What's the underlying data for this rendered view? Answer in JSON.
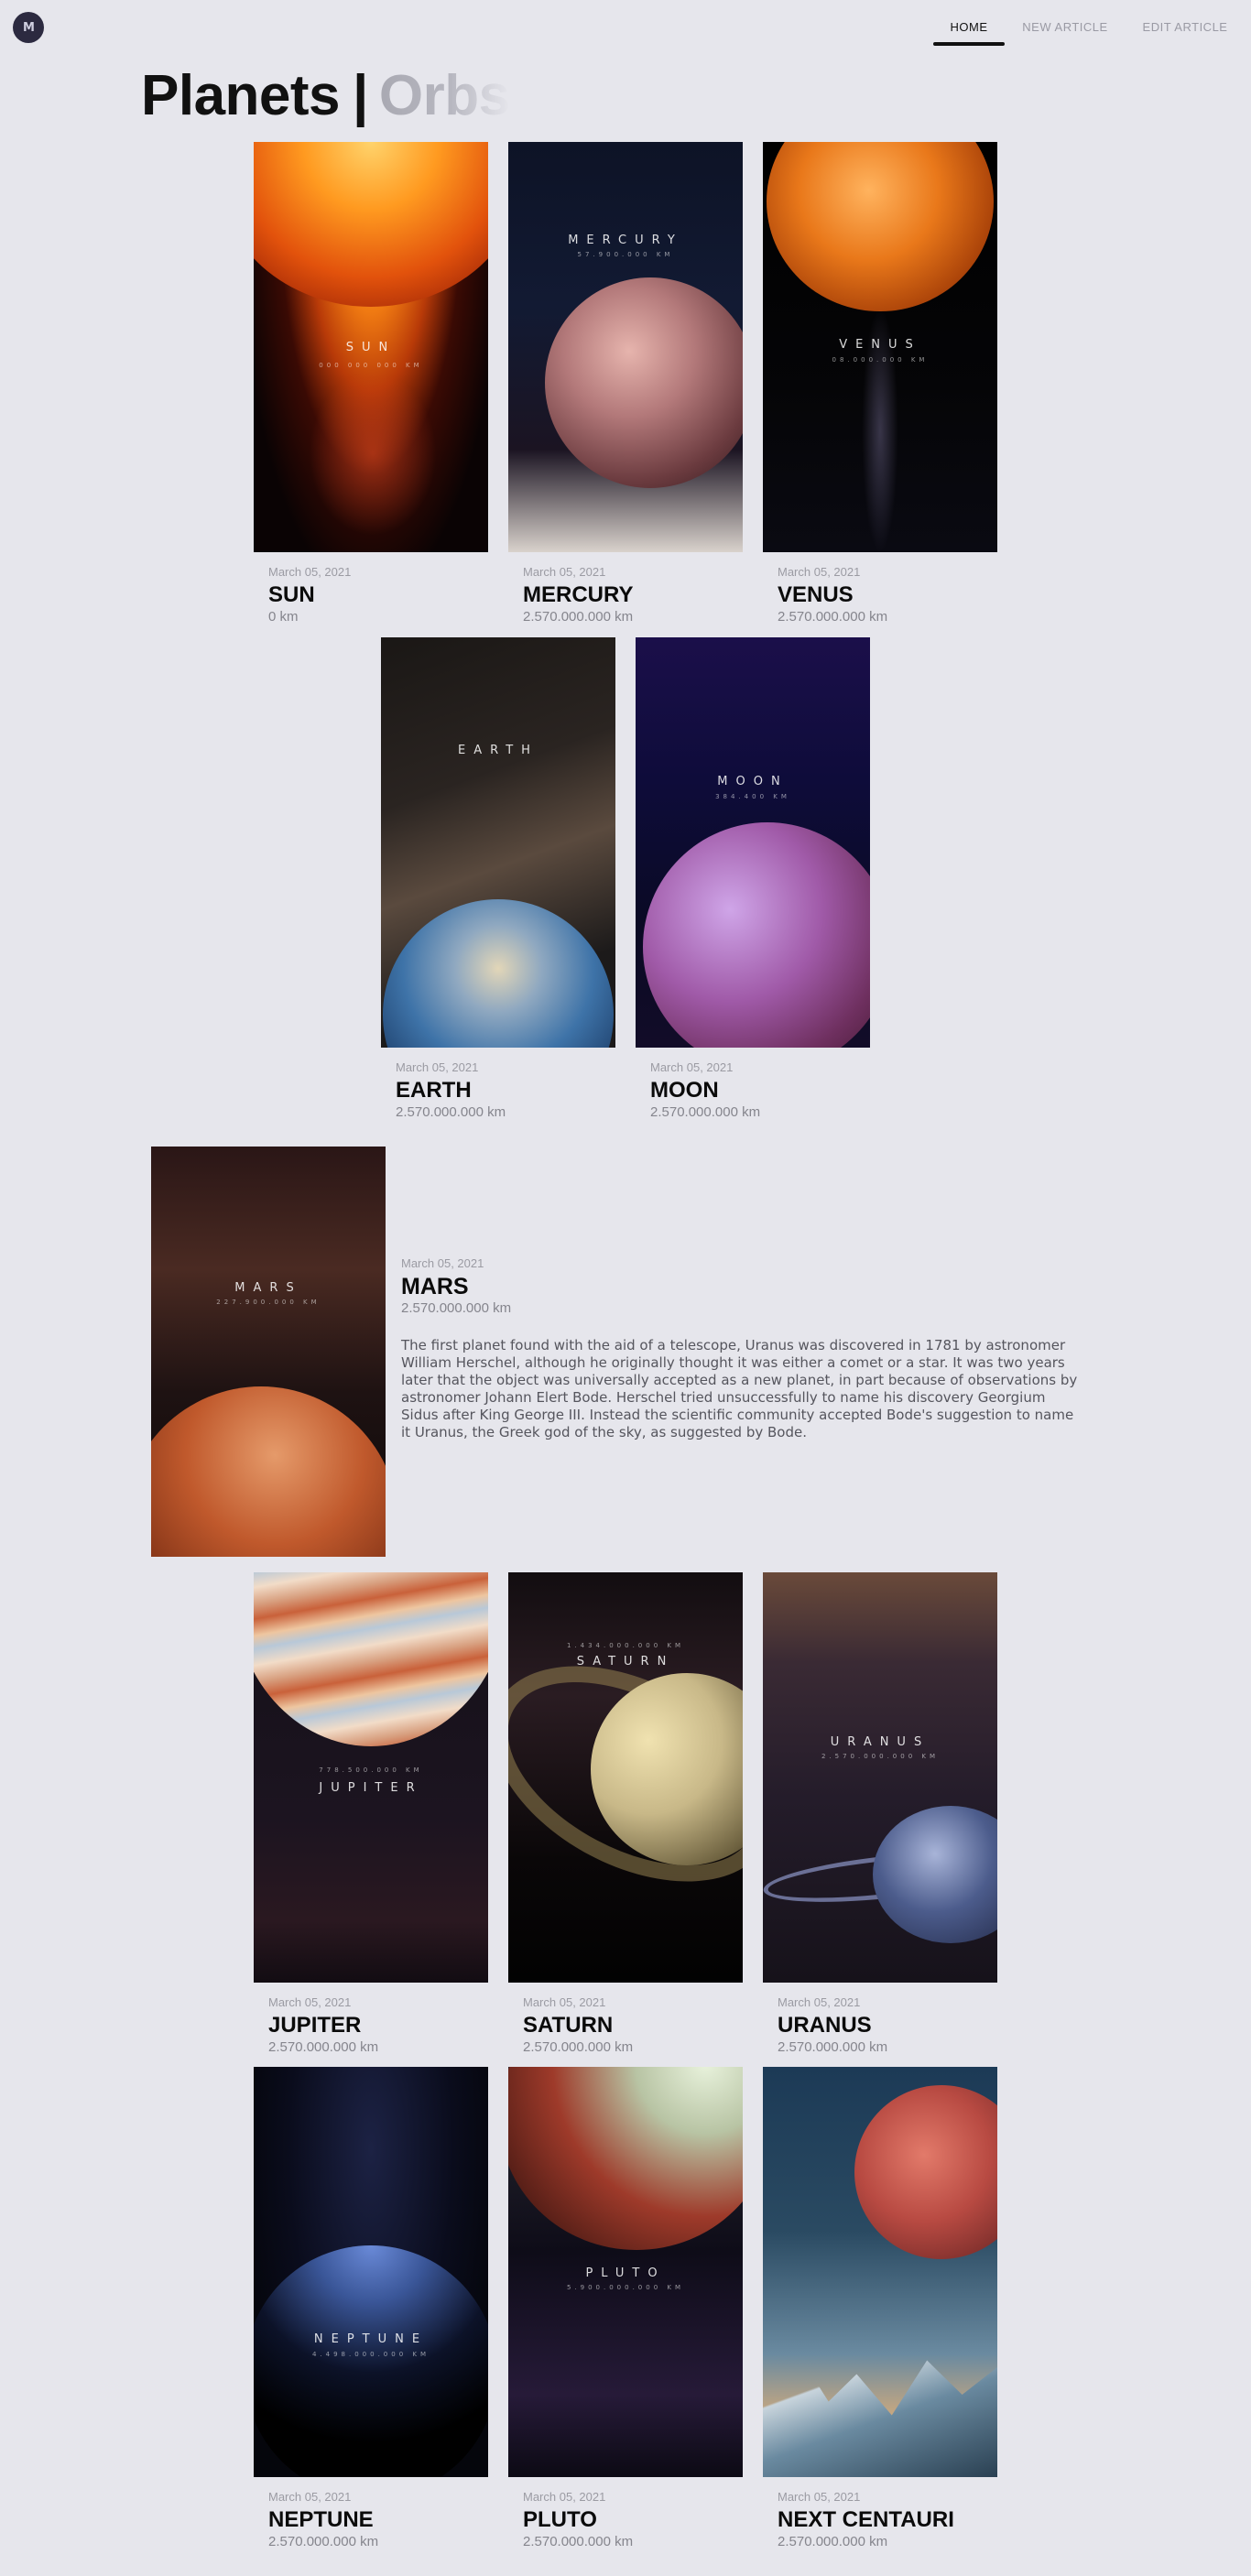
{
  "header": {
    "logo_text": "M",
    "nav": [
      {
        "label": "HOME",
        "active": true
      },
      {
        "label": "NEW ARTICLE",
        "active": false
      },
      {
        "label": "EDIT ARTICLE",
        "active": false
      }
    ]
  },
  "page": {
    "title": "Planets",
    "separator": "|",
    "subtitle": "Orbs"
  },
  "cards": [
    {
      "name": "SUN",
      "date": "March 05, 2021",
      "distance": "0 km",
      "image_title": "SUN",
      "image_sub": "000 000 000 KM",
      "colors": [
        "#f07a12",
        "#3a0a04"
      ]
    },
    {
      "name": "MERCURY",
      "date": "March 05, 2021",
      "distance": "2.570.000.000 km",
      "image_title": "MERCURY",
      "image_sub": "57.900.000 KM",
      "colors": [
        "#b3797a",
        "#0d1326"
      ]
    },
    {
      "name": "VENUS",
      "date": "March 05, 2021",
      "distance": "2.570.000.000 km",
      "image_title": "VENUS",
      "image_sub": "08.000.000 KM",
      "colors": [
        "#e9781a",
        "#050507"
      ]
    },
    {
      "name": "EARTH",
      "date": "March 05, 2021",
      "distance": "2.570.000.000 km",
      "image_title": "EARTH",
      "image_sub": "",
      "colors": [
        "#3e73a8",
        "#2a2421"
      ]
    },
    {
      "name": "MOON",
      "date": "March 05, 2021",
      "distance": "2.570.000.000 km",
      "image_title": "MOON",
      "image_sub": "384.400 KM",
      "colors": [
        "#a05aa8",
        "#0e0c3a"
      ]
    },
    {
      "name": "MARS",
      "date": "March 05, 2021",
      "distance": "2.570.000.000 km",
      "image_title": "MARS",
      "image_sub": "227.900.000 KM",
      "colors": [
        "#c0592c",
        "#2a1616"
      ],
      "description": "The first planet found with the aid of a telescope, Uranus was discovered in 1781 by astronomer William Herschel, although he originally thought it was either a comet or a star. It was two years later that the object was universally accepted as a new planet, in part because of observations by astronomer Johann Elert Bode. Herschel tried unsuccessfully to name his discovery Georgium Sidus after King George III. Instead the scientific community accepted Bode's suggestion to name it Uranus, the Greek god of the sky, as suggested by Bode."
    },
    {
      "name": "JUPITER",
      "date": "March 05, 2021",
      "distance": "2.570.000.000 km",
      "image_title": "JUPITER",
      "image_sub": "778.500.000 KM",
      "colors": [
        "#c9613a",
        "#141018"
      ]
    },
    {
      "name": "SATURN",
      "date": "March 05, 2021",
      "distance": "2.570.000.000 km",
      "image_title": "SATURN",
      "image_sub": "1.434.000.000 KM",
      "colors": [
        "#c8b888",
        "#120d10"
      ]
    },
    {
      "name": "URANUS",
      "date": "March 05, 2021",
      "distance": "2.570.000.000 km",
      "image_title": "URANUS",
      "image_sub": "2.570.000.000 KM",
      "colors": [
        "#4c5c8c",
        "#241c2a"
      ]
    },
    {
      "name": "NEPTUNE",
      "date": "March 05, 2021",
      "distance": "2.570.000.000 km",
      "image_title": "NEPTUNE",
      "image_sub": "4.498.000.000 KM",
      "colors": [
        "#3a5698",
        "#05060c"
      ]
    },
    {
      "name": "PLUTO",
      "date": "March 05, 2021",
      "distance": "2.570.000.000 km",
      "image_title": "PLUTO",
      "image_sub": "5.900.000.000 KM",
      "colors": [
        "#9e3a2a",
        "#0e0c18"
      ]
    },
    {
      "name": "NEXT CENTAURI",
      "date": "March 05, 2021",
      "distance": "2.570.000.000 km",
      "image_title": "",
      "image_sub": "",
      "colors": [
        "#b84a42",
        "#1c3a56"
      ]
    }
  ]
}
